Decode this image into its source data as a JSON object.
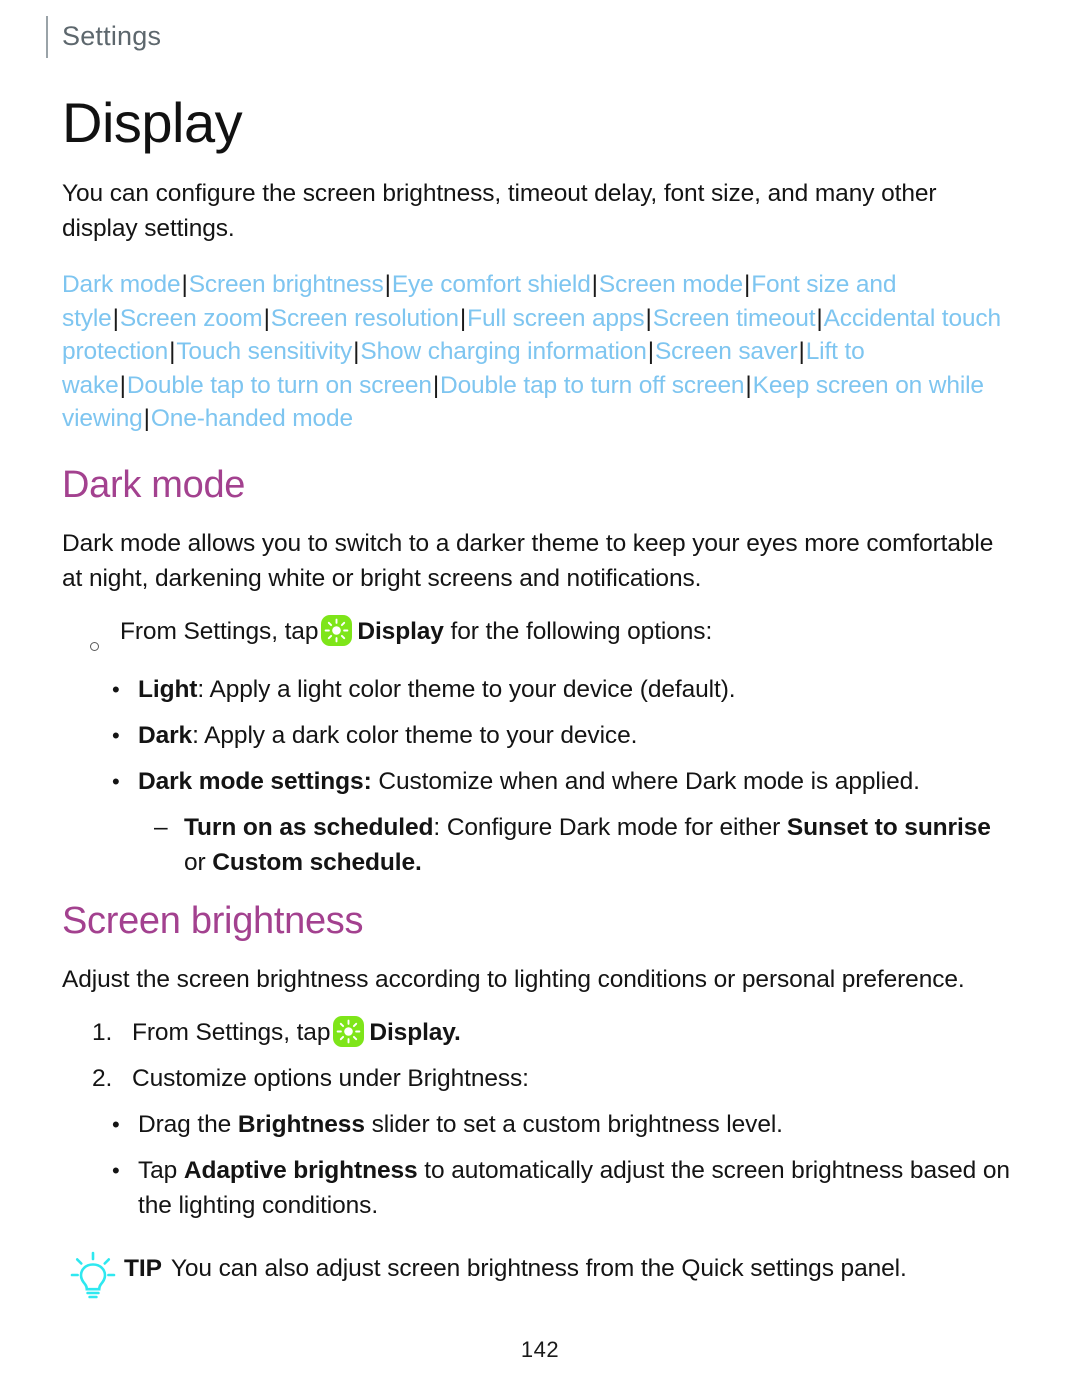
{
  "header": {
    "running_title": "Settings"
  },
  "page_title": "Display",
  "intro": "You can configure the screen brightness, timeout delay, font size, and many other display settings.",
  "nav_links": [
    "Dark mode",
    "Screen brightness",
    "Eye comfort shield",
    "Screen mode",
    "Font size and style",
    "Screen zoom",
    "Screen resolution",
    "Full screen apps",
    "Screen timeout",
    "Accidental touch protection",
    "Touch sensitivity",
    "Show charging information",
    "Screen saver",
    "Lift to wake",
    "Double tap to turn on screen",
    "Double tap to turn off screen",
    "Keep screen on while viewing",
    "One-handed mode"
  ],
  "nav_separator": "|",
  "sections": [
    {
      "heading": "Dark mode",
      "body": "Dark mode allows you to switch to a darker theme to keep your eyes more comfortable at night, darkening white or bright screens and notifications.",
      "step_prefix": "From Settings, tap",
      "step_bold": "Display",
      "step_suffix": "for the following options:",
      "options": [
        {
          "bullet": "•",
          "term": "Light",
          "sep": ":",
          "text": " Apply a light color theme to your device (default)."
        },
        {
          "bullet": "•",
          "term": "Dark",
          "sep": ":",
          "text": " Apply a dark color theme to your device."
        },
        {
          "bullet": "•",
          "term": "Dark mode settings:",
          "sep": "",
          "text": " Customize when and where Dark mode is applied."
        }
      ],
      "sub_option": {
        "bullet": "–",
        "term": "Turn on as scheduled",
        "sep": ":",
        "text_a": " Configure Dark mode for either ",
        "bold_a": "Sunset to sunrise",
        "text_b": " or ",
        "bold_b": "Custom schedule",
        "text_c": "."
      }
    },
    {
      "heading": "Screen brightness",
      "body": "Adjust the screen brightness according to lighting conditions or personal preference.",
      "steps": [
        {
          "number": "1.",
          "prefix": "From Settings, tap",
          "bold": "Display",
          "suffix": "."
        },
        {
          "number": "2.",
          "prefix": "Customize options under Brightness:",
          "bold": "",
          "suffix": ""
        }
      ],
      "options": [
        {
          "bullet": "•",
          "text_a": "Drag the ",
          "bold": "Brightness",
          "text_b": " slider to set a custom brightness level."
        },
        {
          "bullet": "•",
          "text_a": "Tap ",
          "bold": "Adaptive brightness",
          "text_b": " to automatically adjust the screen brightness based on the lighting conditions."
        }
      ]
    }
  ],
  "tip": {
    "label": "TIP",
    "text": "You can also adjust screen brightness from the Quick settings panel."
  },
  "page_number": "142",
  "colors": {
    "link": "#7ec5f0",
    "heading_accent": "#a3418f",
    "icon_green": "#7ee519",
    "tip_cyan": "#2ee8f0",
    "body_text": "#141414",
    "running_header": "#5d676d"
  },
  "icons": {
    "display": "brightness-sun-icon",
    "tip": "lightbulb-icon"
  }
}
